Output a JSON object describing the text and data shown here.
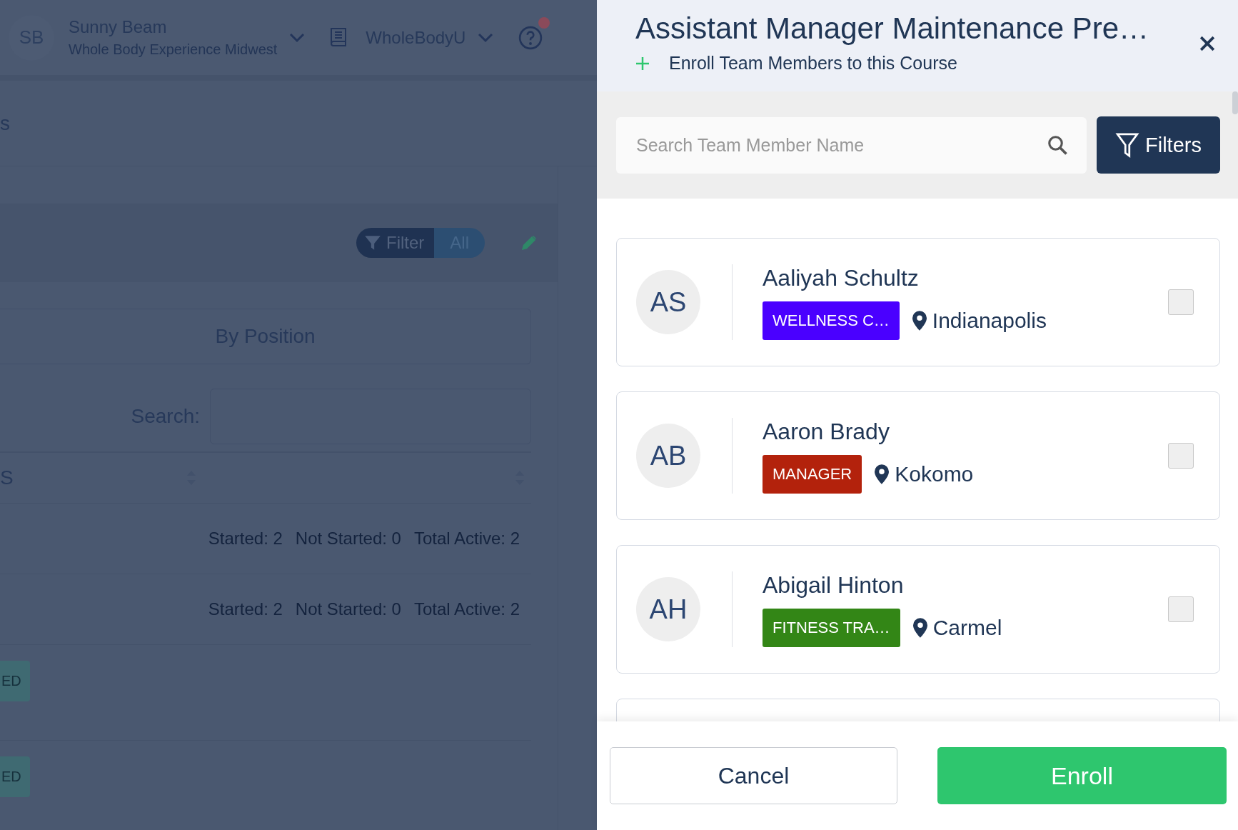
{
  "background_page": {
    "user": {
      "initials": "SB",
      "name": "Sunny Beam",
      "organization": "Whole Body Experience Midwest"
    },
    "app_switcher": {
      "label": "WholeBodyU"
    },
    "help": {
      "has_notification": true
    },
    "page_title": "s",
    "filter_pill": {
      "label": "Filter",
      "value": "All"
    },
    "view_tab": "By Position",
    "search": {
      "label": "Search:"
    },
    "table": {
      "columns": [
        {
          "label": "S"
        }
      ],
      "rows": [
        {
          "kind": "stats",
          "cells": [
            "Started: 2",
            "Not Started: 0",
            "Total Active: 2"
          ]
        },
        {
          "kind": "stats",
          "cells": [
            "Started: 2",
            "Not Started: 0",
            "Total Active: 2"
          ]
        },
        {
          "kind": "badge",
          "badge": "ED"
        },
        {
          "kind": "badge",
          "badge": "ED"
        }
      ]
    }
  },
  "enroll_panel": {
    "title": "Assistant Manager Maintenance Pre…",
    "subtitle": "Enroll Team Members to this Course",
    "search": {
      "placeholder": "Search Team Member Name"
    },
    "filter_button": "Filters",
    "members": [
      {
        "initials": "AS",
        "name": "Aaliyah Schultz",
        "tag": {
          "label": "WELLNESS C…",
          "color": "#4a00ff"
        },
        "location": "Indianapolis",
        "checked": false
      },
      {
        "initials": "AB",
        "name": "Aaron Brady",
        "tag": {
          "label": "MANAGER",
          "color": "#b3220c"
        },
        "location": "Kokomo",
        "checked": false
      },
      {
        "initials": "AH",
        "name": "Abigail Hinton",
        "tag": {
          "label": "FITNESS TRA…",
          "color": "#338616"
        },
        "location": "Carmel",
        "checked": false
      }
    ],
    "buttons": {
      "cancel": "Cancel",
      "confirm": "Enroll"
    }
  }
}
